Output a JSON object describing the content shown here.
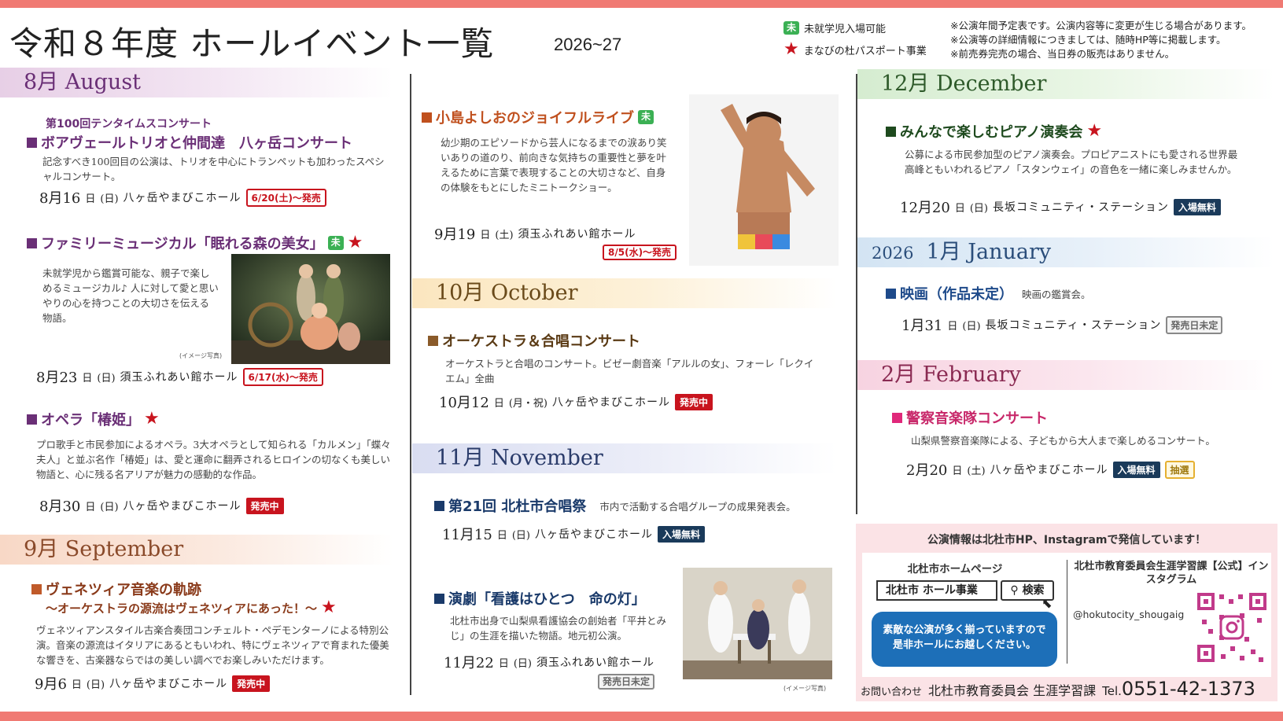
{
  "header": {
    "title": "令和８年度 ホールイベント一覧",
    "year": "2026~27"
  },
  "legend": {
    "mishu_icon": "未",
    "mishu_label": "未就学児入場可能",
    "star_label": "まなびの杜パスポート事業"
  },
  "notes": [
    "※公演年間予定表です。公演内容等に変更が生じる場合があります。",
    "※公演等の詳細情報につきましては、随時HP等に掲載します。",
    "※前売券完売の場合、当日券の販売はありません。"
  ],
  "colors": {
    "accent": "#f07a73",
    "sale_red": "#c8141e",
    "free_navy": "#1a3a5a",
    "mishu_green": "#3bb054"
  },
  "months": {
    "aug": "8月 August",
    "sep": "9月 September",
    "oct": "10月 October",
    "nov": "11月 November",
    "dec": "12月 December",
    "jan_year": "2026",
    "jan": "1月 January",
    "feb": "2月 February"
  },
  "events": {
    "aug1": {
      "subtitle": "第100回テンタイムスコンサート",
      "title": "ボアヴェールトリオと仲間達　八ヶ岳コンサート",
      "desc": "記念すべき100回目の公演は、トリオを中心にトランペットも加わったスペシャルコンサート。",
      "date": "8月16",
      "dow": "(日)",
      "venue": "八ヶ岳やまびこホール",
      "badge": "6/20(土)～発売"
    },
    "aug2": {
      "title": "ファミリーミュージカル「眠れる森の美女」",
      "desc": "未就学児から鑑賞可能な、親子で楽しめるミュージカル♪ 人に対して愛と思いやりの心を持つことの大切さを伝える物語。",
      "caption": "(イメージ写真)",
      "date": "8月23",
      "dow": "(日)",
      "venue": "須玉ふれあい館ホール",
      "badge": "6/17(水)～発売"
    },
    "aug3": {
      "title": "オペラ「椿姫」",
      "desc": "プロ歌手と市民参加によるオペラ。3大オペラとして知られる「カルメン」「蝶々夫人」と並ぶ名作「椿姫」は、愛と運命に翻弄されるヒロインの切なくも美しい物語と、心に残る名アリアが魅力の感動的な作品。",
      "date": "8月30",
      "dow": "(日)",
      "venue": "八ヶ岳やまびこホール",
      "badge": "発売中"
    },
    "sep1": {
      "title": "ヴェネツィア音楽の軌跡",
      "subtitle": "～オーケストラの源流はヴェネツィアにあった！～",
      "desc": "ヴェネツィアンスタイル古楽合奏団コンチェルト・ペデモンターノによる特別公演。音楽の源流はイタリアにあるともいわれ、特にヴェネツィアで育まれた優美な響きを、古楽器ならではの美しい調べでお楽しみいただけます。",
      "date": "9月6",
      "dow": "(日)",
      "venue": "八ヶ岳やまびこホール",
      "badge": "発売中"
    },
    "sep2": {
      "title": "小島よしおのジョイフルライブ",
      "desc": "幼少期のエピソードから芸人になるまでの涙あり笑いありの道のり、前向きな気持ちの重要性と夢を叶えるために言葉で表現することの大切さなど、自身の体験をもとにしたミニトークショー。",
      "date": "9月19",
      "dow": "(土)",
      "venue": "須玉ふれあい館ホール",
      "badge": "8/5(水)～発売"
    },
    "oct1": {
      "title": "オーケストラ＆合唱コンサート",
      "desc": "オーケストラと合唱のコンサート。ビゼー劇音楽「アルルの女」、フォーレ「レクイエム」全曲",
      "date": "10月12",
      "dow": "(月・祝)",
      "venue": "八ヶ岳やまびこホール",
      "badge": "発売中"
    },
    "nov1": {
      "title": "第21回 北杜市合唱祭",
      "desc": "市内で活動する合唱グループの成果発表会。",
      "date": "11月15",
      "dow": "(日)",
      "venue": "八ヶ岳やまびこホール",
      "badge": "入場無料"
    },
    "nov2": {
      "title": "演劇「看護はひとつ　命の灯」",
      "desc": "北杜市出身で山梨県看護協会の創始者「平井とみじ」の生涯を描いた物語。地元初公演。",
      "caption": "(イメージ写真)",
      "date": "11月22",
      "dow": "(日)",
      "venue": "須玉ふれあい館ホール",
      "badge": "発売日未定"
    },
    "dec1": {
      "title": "みんなで楽しむピアノ演奏会",
      "desc": "公募による市民参加型のピアノ演奏会。プロピアニストにも愛される世界最高峰ともいわれるピアノ「スタンウェイ」の音色を一緒に楽しみませんか。",
      "date": "12月20",
      "dow": "(日)",
      "venue": "長坂コミュニティ・ステーション",
      "badge": "入場無料"
    },
    "jan1": {
      "title": "映画（作品未定）",
      "desc": "映画の鑑賞会。",
      "date": "1月31",
      "dow": "(日)",
      "venue": "長坂コミュニティ・ステーション",
      "badge": "発売日未定"
    },
    "feb1": {
      "title": "警察音楽隊コンサート",
      "desc": "山梨県警察音楽隊による、子どもから大人まで楽しめるコンサート。",
      "date": "2月20",
      "dow": "(土)",
      "venue": "八ヶ岳やまびこホール",
      "badge": "入場無料",
      "badge2": "抽選"
    }
  },
  "info": {
    "headline": "公演情報は北杜市HP、Instagramで発信しています！",
    "hp_label": "北杜市ホームページ",
    "search_value": "北杜市 ホール事業",
    "search_button": "検索",
    "bubble": "素敵な公演が多く揃っていますので是非ホールにお越しください。",
    "ig_label": "北杜市教育委員会生涯学習課【公式】インスタグラム",
    "ig_handle": "@hokutocity_shougaig",
    "contact_prefix": "お問い合わせ",
    "contact_org": "北杜市教育委員会 生涯学習課",
    "tel_label": "Tel.",
    "tel": "0551-42-1373"
  }
}
